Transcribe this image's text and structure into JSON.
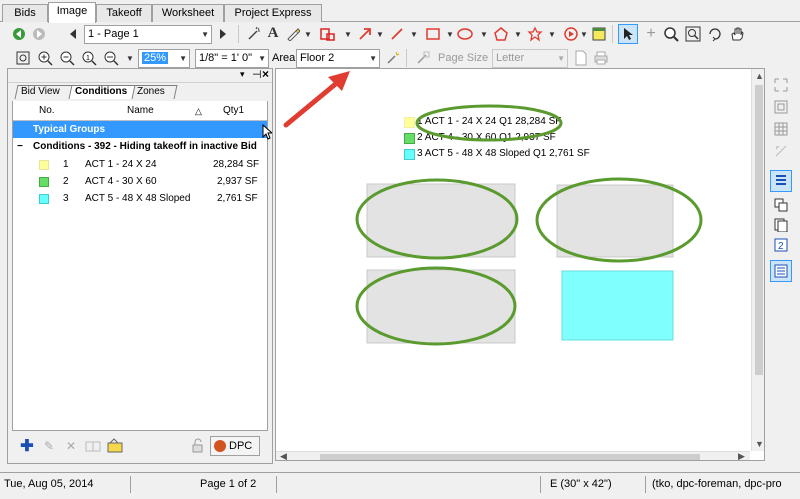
{
  "tabs": [
    "Bids",
    "Image",
    "Takeoff",
    "Worksheet",
    "Project Express"
  ],
  "toolbar1": {
    "page_select": "1 - Page 1"
  },
  "toolbar2": {
    "zoom_value": "25%",
    "scale_value": "1/8\" = 1' 0\"",
    "area_label": "Area",
    "area_value": "Floor 2",
    "page_size_label": "Page Size",
    "page_size_value": "Letter"
  },
  "left_panel": {
    "subtabs": [
      "Bid View",
      "Conditions",
      "Zones"
    ],
    "columns": {
      "no": "No.",
      "name": "Name",
      "qty": "Qty1"
    },
    "group_label": "Typical Groups",
    "conditions_header": "Conditions - 392 - Hiding takeoff in inactive Bid",
    "rows": [
      {
        "no": "1",
        "name": "ACT 1 - 24 X 24",
        "qty": "28,284 SF",
        "color": "#ffff99"
      },
      {
        "no": "2",
        "name": "ACT 4 - 30 X 60",
        "qty": "2,937 SF",
        "color": "#66dd66"
      },
      {
        "no": "3",
        "name": "ACT 5 - 48 X 48 Sloped",
        "qty": "2,761 SF",
        "color": "#66ffff"
      }
    ],
    "dpc_label": "DPC"
  },
  "canvas": {
    "legend": [
      {
        "text": "1 ACT 1 - 24 X 24 Q1 28,284 SF",
        "color": "#ffff99"
      },
      {
        "text": "2 ACT 4 - 30 X 60 Q1 2,937 SF",
        "color": "#66dd66"
      },
      {
        "text": "3 ACT 5 - 48 X 48 Sloped Q1 2,761 SF",
        "color": "#66ffff"
      }
    ]
  },
  "status": {
    "date": "Tue, Aug 05, 2014",
    "page": "Page 1 of 2",
    "paper": "E (30\" x 42\")",
    "users": "(tko, dpc-foreman, dpc-pro"
  },
  "colors": {
    "selection_blue": "#3399ff",
    "annotation_green": "#5a9a2e",
    "arrow_red": "#e03c31",
    "area_gray": "#e3e3e3",
    "area_cyan": "#80ffff"
  }
}
